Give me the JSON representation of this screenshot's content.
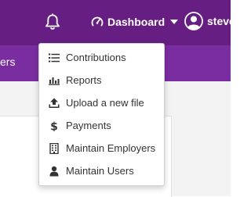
{
  "header": {
    "notifications_icon": "bell-icon",
    "dashboard_label": "Dashboard",
    "user_name": "steve"
  },
  "subnav": {
    "partial_item_label": "sers"
  },
  "dropdown": {
    "items": [
      {
        "label": "Contributions",
        "icon": "list-icon"
      },
      {
        "label": "Reports",
        "icon": "bar-chart-icon"
      },
      {
        "label": "Upload a new file",
        "icon": "upload-icon"
      },
      {
        "label": "Payments",
        "icon": "dollar-icon"
      },
      {
        "label": "Maintain Employers",
        "icon": "building-icon"
      },
      {
        "label": "Maintain Users",
        "icon": "user-icon"
      }
    ]
  },
  "colors": {
    "topbar": "#661e82",
    "subnav": "#7a2da1",
    "menu_text": "#333333"
  }
}
